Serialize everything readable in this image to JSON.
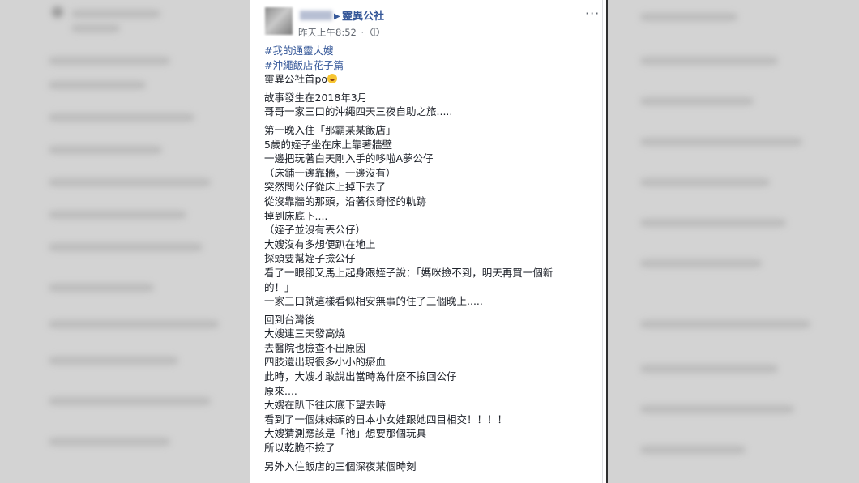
{
  "post": {
    "author_name": "",
    "group_name": "靈異公社",
    "timestamp": "昨天上午8:52",
    "meta_dot": "·",
    "more_menu": "···",
    "emoji_icon": "laughing-emoji-icon"
  },
  "content": {
    "hashtag1": "#我的通靈大嫂",
    "hashtag2": "#沖繩飯店花子篇",
    "intro": "靈異公社首po",
    "p1": [
      "故事發生在2018年3月",
      "哥哥一家三口的沖繩四天三夜自助之旅....."
    ],
    "p2": [
      "第一晚入住「那霸某某飯店」",
      "5歲的姪子坐在床上靠著牆壁",
      "一邊把玩著白天剛入手的哆啦A夢公仔",
      "（床鋪一邊靠牆，一邊沒有）",
      "突然間公仔從床上掉下去了",
      "從沒靠牆的那頭，沿著很奇怪的軌跡",
      "掉到床底下....",
      "（姪子並沒有丟公仔）",
      "大嫂沒有多想便趴在地上",
      "探頭要幫姪子撿公仔",
      "看了一眼卻又馬上起身跟姪子說：「媽咪撿不到，明天再買一個新",
      "的！」",
      "一家三口就這樣看似相安無事的住了三個晚上....."
    ],
    "p3": [
      "回到台灣後",
      "大嫂連三天發高燒",
      "去醫院也檢查不出原因",
      "四肢還出現很多小小的瘀血",
      "此時，大嫂才敢說出當時為什麼不撿回公仔",
      "原來....",
      "大嫂在趴下往床底下望去時",
      "看到了一個妹妹頭的日本小女娃跟她四目相交！！！！",
      "大嫂猜測應該是「祂」想要那個玩具",
      "所以乾脆不撿了"
    ],
    "p4": [
      "另外入住飯店的三個深夜某個時刻"
    ]
  }
}
